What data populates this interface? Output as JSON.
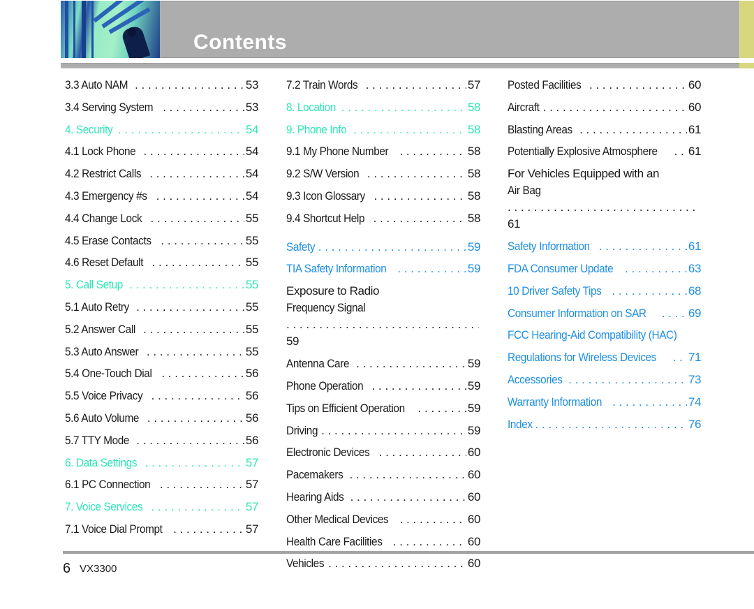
{
  "header": {
    "title": "Contents",
    "accent_color": "#d8d67e",
    "bar_color": "#adadad"
  },
  "colors": {
    "section_mint": "#2ee6b8",
    "section_blue": "#1e8fe6",
    "body_text": "#1a1a1a"
  },
  "columns": [
    {
      "entries": [
        {
          "title": "3.3 Auto NAM",
          "page": "53",
          "style": "normal"
        },
        {
          "title": "3.4 Serving System",
          "page": "53",
          "style": "normal"
        },
        {
          "title": "4. Security",
          "page": "54",
          "style": "mint"
        },
        {
          "title": "4.1 Lock Phone",
          "page": "54",
          "style": "normal"
        },
        {
          "title": "4.2 Restrict Calls",
          "page": "54",
          "style": "normal"
        },
        {
          "title": "4.3 Emergency #s",
          "page": "54",
          "style": "normal"
        },
        {
          "title": "4.4 Change Lock",
          "page": "55",
          "style": "normal"
        },
        {
          "title": "4.5 Erase Contacts",
          "page": "55",
          "style": "normal"
        },
        {
          "title": "4.6 Reset Default",
          "page": "55",
          "style": "normal"
        },
        {
          "title": "5. Call Setup",
          "page": "55",
          "style": "mint"
        },
        {
          "title": "5.1 Auto Retry",
          "page": "55",
          "style": "normal"
        },
        {
          "title": "5.2 Answer Call",
          "page": "55",
          "style": "normal"
        },
        {
          "title": "5.3 Auto Answer",
          "page": "55",
          "style": "normal"
        },
        {
          "title": "5.4 One-Touch Dial",
          "page": "56",
          "style": "normal"
        },
        {
          "title": "5.5 Voice Privacy",
          "page": "56",
          "style": "normal"
        },
        {
          "title": "5.6 Auto Volume",
          "page": "56",
          "style": "normal"
        },
        {
          "title": "5.7 TTY Mode",
          "page": "56",
          "style": "normal"
        },
        {
          "title": "6. Data Settings",
          "page": "57",
          "style": "mint"
        },
        {
          "title": "6.1 PC Connection",
          "page": "57",
          "style": "normal"
        },
        {
          "title": "7. Voice Services",
          "page": "57",
          "style": "mint"
        },
        {
          "title": "7.1 Voice Dial Prompt",
          "page": "57",
          "style": "normal"
        }
      ]
    },
    {
      "entries": [
        {
          "title": "7.2 Train Words",
          "page": "57",
          "style": "normal"
        },
        {
          "title": "8. Location",
          "page": "58",
          "style": "mint"
        },
        {
          "title": "9. Phone Info",
          "page": "58",
          "style": "mint"
        },
        {
          "title": "9.1 My Phone Number",
          "page": "58",
          "style": "normal"
        },
        {
          "title": "9.2 S/W Version",
          "page": "58",
          "style": "normal"
        },
        {
          "title": "9.3 Icon Glossary",
          "page": "58",
          "style": "normal"
        },
        {
          "title": "9.4 Shortcut Help",
          "page": "58",
          "style": "normal"
        },
        {
          "title": "Safety",
          "page": "59",
          "style": "blue"
        },
        {
          "title": "TIA Safety Information",
          "page": "59",
          "style": "blue"
        },
        {
          "title_line1": "Exposure to Radio",
          "title": "Frequency Signal",
          "page": "59",
          "style": "normal"
        },
        {
          "title": "Antenna Care",
          "page": "59",
          "style": "normal"
        },
        {
          "title": "Phone Operation",
          "page": "59",
          "style": "normal"
        },
        {
          "title": "Tips on Efficient Operation",
          "page": "59",
          "style": "normal"
        },
        {
          "title": "Driving",
          "page": "59",
          "style": "normal"
        },
        {
          "title": "Electronic Devices",
          "page": "60",
          "style": "normal"
        },
        {
          "title": "Pacemakers",
          "page": "60",
          "style": "normal"
        },
        {
          "title": "Hearing Aids",
          "page": "60",
          "style": "normal"
        },
        {
          "title": "Other Medical Devices",
          "page": "60",
          "style": "normal"
        },
        {
          "title": "Health Care Facilities",
          "page": "60",
          "style": "normal"
        },
        {
          "title": "Vehicles",
          "page": "60",
          "style": "normal"
        }
      ]
    },
    {
      "entries": [
        {
          "title": "Posted Facilities",
          "page": "60",
          "style": "normal"
        },
        {
          "title": "Aircraft",
          "page": "60",
          "style": "normal"
        },
        {
          "title": "Blasting Areas",
          "page": "61",
          "style": "normal"
        },
        {
          "title": "Potentially Explosive Atmosphere",
          "page": "61",
          "style": "normal"
        },
        {
          "title_line1": "For Vehicles Equipped with an",
          "title": "Air Bag",
          "page": "61",
          "style": "normal"
        },
        {
          "title": "Safety Information",
          "page": "61",
          "style": "blue"
        },
        {
          "title": "FDA Consumer Update",
          "page": "63",
          "style": "blue"
        },
        {
          "title": "10 Driver Safety Tips",
          "page": "68",
          "style": "blue"
        },
        {
          "title": "Consumer Information on SAR",
          "page": "69",
          "style": "blue"
        },
        {
          "title": "FCC Hearing-Aid Compatibility (HAC)",
          "page": "",
          "style": "blue"
        },
        {
          "title": "Regulations for Wireless Devices",
          "page": "71",
          "style": "blue"
        },
        {
          "title": "Accessories",
          "page": "73",
          "style": "blue"
        },
        {
          "title": "Warranty Information",
          "page": "74",
          "style": "blue"
        },
        {
          "title": "Index",
          "page": "76",
          "style": "blue"
        }
      ]
    }
  ],
  "footer": {
    "page_number": "6",
    "model": "VX3300"
  }
}
